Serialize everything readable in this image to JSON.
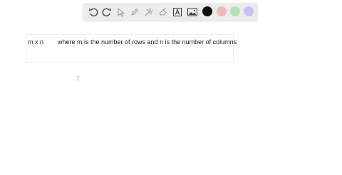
{
  "toolbar": {
    "tools": [
      {
        "icon": "undo-icon"
      },
      {
        "icon": "redo-icon"
      },
      {
        "icon": "select-arrow-icon"
      },
      {
        "icon": "pencil-icon"
      },
      {
        "icon": "tools-icon"
      },
      {
        "icon": "eraser-icon"
      },
      {
        "icon": "text-icon"
      },
      {
        "icon": "image-icon"
      }
    ],
    "colors": [
      {
        "name": "black",
        "hex": "#111111"
      },
      {
        "name": "pink",
        "hex": "#f0b6b8"
      },
      {
        "name": "green",
        "hex": "#b9e0b2"
      },
      {
        "name": "lavender",
        "hex": "#c6c2f0"
      }
    ]
  },
  "canvas": {
    "text_left": "m x n",
    "text_right": "where m is the number of rows and n is the number of columns"
  }
}
